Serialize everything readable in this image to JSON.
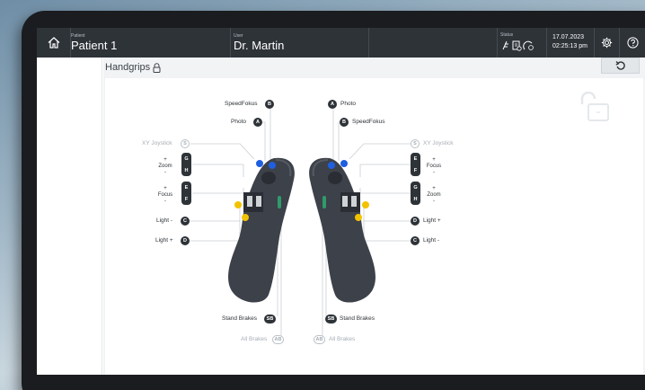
{
  "topbar": {
    "patient_label": "Patient",
    "patient_value": "Patient 1",
    "user_label": "User",
    "user_value": "Dr. Martin",
    "status_label": "Status",
    "date": "17.07.2023",
    "time": "02:25:13 pm"
  },
  "page": {
    "title": "Handgrips"
  },
  "left_grip": {
    "speedfokus": "SpeedFokus",
    "speedfokus_key": "B",
    "photo": "Photo",
    "photo_key": "A",
    "xy_joystick": "XY Joystick",
    "xy_key": "S",
    "zoom_plus": "+",
    "zoom": "Zoom",
    "zoom_minus": "-",
    "zoom_key_top": "G",
    "zoom_key_bottom": "H",
    "focus_plus": "+",
    "focus": "Focus",
    "focus_minus": "-",
    "focus_key_top": "E",
    "focus_key_bottom": "F",
    "light_minus": "Light -",
    "light_minus_key": "C",
    "light_plus": "Light +",
    "light_plus_key": "D",
    "stand_brakes": "Stand Brakes",
    "stand_brakes_key": "SB",
    "all_brakes": "All Brakes",
    "all_brakes_key": "AB"
  },
  "right_grip": {
    "photo": "Photo",
    "photo_key": "A",
    "speedfokus": "SpeedFokus",
    "speedfokus_key": "B",
    "xy_joystick": "XY Joystick",
    "xy_key": "S",
    "focus_plus": "+",
    "focus": "Focus",
    "focus_minus": "-",
    "focus_key_top": "E",
    "focus_key_bottom": "F",
    "zoom_plus": "+",
    "zoom": "Zoom",
    "zoom_minus": "-",
    "zoom_key_top": "G",
    "zoom_key_bottom": "H",
    "light_plus": "Light +",
    "light_plus_key": "D",
    "light_minus": "Light -",
    "light_minus_key": "C",
    "stand_brakes": "Stand Brakes",
    "stand_brakes_key": "SB",
    "all_brakes": "All Brakes",
    "all_brakes_key": "AB"
  },
  "colors": {
    "topbar": "#2e3338",
    "badge": "#2e3338",
    "button_blue": "#1f5fe0",
    "button_yellow": "#f2c200",
    "button_green": "#2f9b6a",
    "leader_line": "#c9ced3"
  },
  "icons": [
    "home-icon",
    "lock-icon",
    "undo-icon",
    "settings-icon",
    "help-icon",
    "status-icons",
    "unlock-icon"
  ]
}
